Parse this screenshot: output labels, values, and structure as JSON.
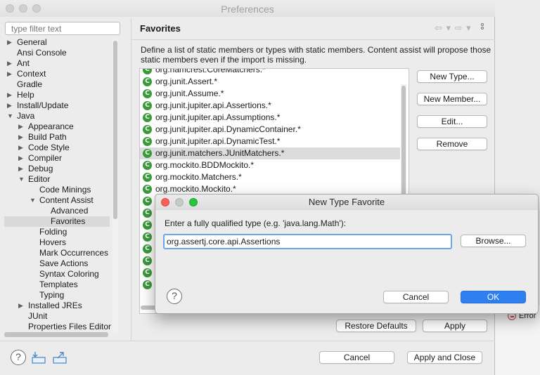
{
  "window": {
    "title": "Preferences"
  },
  "filter": {
    "placeholder": "type filter text"
  },
  "tree": {
    "items": [
      {
        "label": "General",
        "expandable": true,
        "expanded": false,
        "depth": 0,
        "selected": false
      },
      {
        "label": "Ansi Console",
        "expandable": false,
        "expanded": false,
        "depth": 0,
        "selected": false
      },
      {
        "label": "Ant",
        "expandable": true,
        "expanded": false,
        "depth": 0,
        "selected": false
      },
      {
        "label": "Context",
        "expandable": true,
        "expanded": false,
        "depth": 0,
        "selected": false
      },
      {
        "label": "Gradle",
        "expandable": false,
        "expanded": false,
        "depth": 0,
        "selected": false
      },
      {
        "label": "Help",
        "expandable": true,
        "expanded": false,
        "depth": 0,
        "selected": false
      },
      {
        "label": "Install/Update",
        "expandable": true,
        "expanded": false,
        "depth": 0,
        "selected": false
      },
      {
        "label": "Java",
        "expandable": true,
        "expanded": true,
        "depth": 0,
        "selected": false
      },
      {
        "label": "Appearance",
        "expandable": true,
        "expanded": false,
        "depth": 1,
        "selected": false
      },
      {
        "label": "Build Path",
        "expandable": true,
        "expanded": false,
        "depth": 1,
        "selected": false
      },
      {
        "label": "Code Style",
        "expandable": true,
        "expanded": false,
        "depth": 1,
        "selected": false
      },
      {
        "label": "Compiler",
        "expandable": true,
        "expanded": false,
        "depth": 1,
        "selected": false
      },
      {
        "label": "Debug",
        "expandable": true,
        "expanded": false,
        "depth": 1,
        "selected": false
      },
      {
        "label": "Editor",
        "expandable": true,
        "expanded": true,
        "depth": 1,
        "selected": false
      },
      {
        "label": "Code Minings",
        "expandable": false,
        "expanded": false,
        "depth": 2,
        "selected": false
      },
      {
        "label": "Content Assist",
        "expandable": true,
        "expanded": true,
        "depth": 2,
        "selected": false
      },
      {
        "label": "Advanced",
        "expandable": false,
        "expanded": false,
        "depth": 3,
        "selected": false
      },
      {
        "label": "Favorites",
        "expandable": false,
        "expanded": false,
        "depth": 3,
        "selected": true
      },
      {
        "label": "Folding",
        "expandable": false,
        "expanded": false,
        "depth": 2,
        "selected": false
      },
      {
        "label": "Hovers",
        "expandable": false,
        "expanded": false,
        "depth": 2,
        "selected": false
      },
      {
        "label": "Mark Occurrences",
        "expandable": false,
        "expanded": false,
        "depth": 2,
        "selected": false
      },
      {
        "label": "Save Actions",
        "expandable": false,
        "expanded": false,
        "depth": 2,
        "selected": false
      },
      {
        "label": "Syntax Coloring",
        "expandable": false,
        "expanded": false,
        "depth": 2,
        "selected": false
      },
      {
        "label": "Templates",
        "expandable": false,
        "expanded": false,
        "depth": 2,
        "selected": false
      },
      {
        "label": "Typing",
        "expandable": false,
        "expanded": false,
        "depth": 2,
        "selected": false
      },
      {
        "label": "Installed JREs",
        "expandable": true,
        "expanded": false,
        "depth": 1,
        "selected": false
      },
      {
        "label": "JUnit",
        "expandable": false,
        "expanded": false,
        "depth": 1,
        "selected": false
      },
      {
        "label": "Properties Files Editor",
        "expandable": false,
        "expanded": false,
        "depth": 1,
        "selected": false
      }
    ]
  },
  "page": {
    "title": "Favorites",
    "nav_back": "⇦ ▾",
    "nav_forward": "⇨ ▾",
    "description": "Define a list of static members or types with static members. Content assist will propose those static members even if the import is missing."
  },
  "favorites": {
    "icon_letter": "C",
    "items": [
      {
        "label": "org.hamcrest.CoreMatchers.*",
        "selected": false
      },
      {
        "label": "org.junit.Assert.*",
        "selected": false
      },
      {
        "label": "org.junit.Assume.*",
        "selected": false
      },
      {
        "label": "org.junit.jupiter.api.Assertions.*",
        "selected": false
      },
      {
        "label": "org.junit.jupiter.api.Assumptions.*",
        "selected": false
      },
      {
        "label": "org.junit.jupiter.api.DynamicContainer.*",
        "selected": false
      },
      {
        "label": "org.junit.jupiter.api.DynamicTest.*",
        "selected": false
      },
      {
        "label": "org.junit.matchers.JUnitMatchers.*",
        "selected": true
      },
      {
        "label": "org.mockito.BDDMockito.*",
        "selected": false
      },
      {
        "label": "org.mockito.Matchers.*",
        "selected": false
      },
      {
        "label": "org.mockito.Mockito.*",
        "selected": false
      },
      {
        "label": "",
        "selected": false
      },
      {
        "label": "",
        "selected": false
      },
      {
        "label": "",
        "selected": false
      },
      {
        "label": "",
        "selected": false
      },
      {
        "label": "",
        "selected": false
      },
      {
        "label": "",
        "selected": false
      },
      {
        "label": "",
        "selected": false
      },
      {
        "label": "",
        "selected": false
      }
    ]
  },
  "buttons": {
    "new_type": "New Type...",
    "new_member": "New Member...",
    "edit": "Edit...",
    "remove": "Remove",
    "restore_defaults": "Restore Defaults",
    "apply": "Apply",
    "cancel": "Cancel",
    "apply_and_close": "Apply and Close"
  },
  "dialog": {
    "title": "New Type Favorite",
    "prompt": "Enter a fully qualified type (e.g. 'java.lang.Math'):",
    "input_value": "org.assertj.core.api.Assertions",
    "browse": "Browse...",
    "cancel": "Cancel",
    "ok": "OK",
    "help": "?"
  },
  "background": {
    "error_label": "Error"
  },
  "bottom_bar": {
    "help": "?"
  },
  "colors": {
    "accent": "#2e7ff0",
    "focus_ring": "#6ea4e8",
    "class_icon": "#3a9a3a",
    "traffic_close": "#fc5f57",
    "traffic_min": "#c8c8c8",
    "traffic_max": "#2ac33f"
  }
}
